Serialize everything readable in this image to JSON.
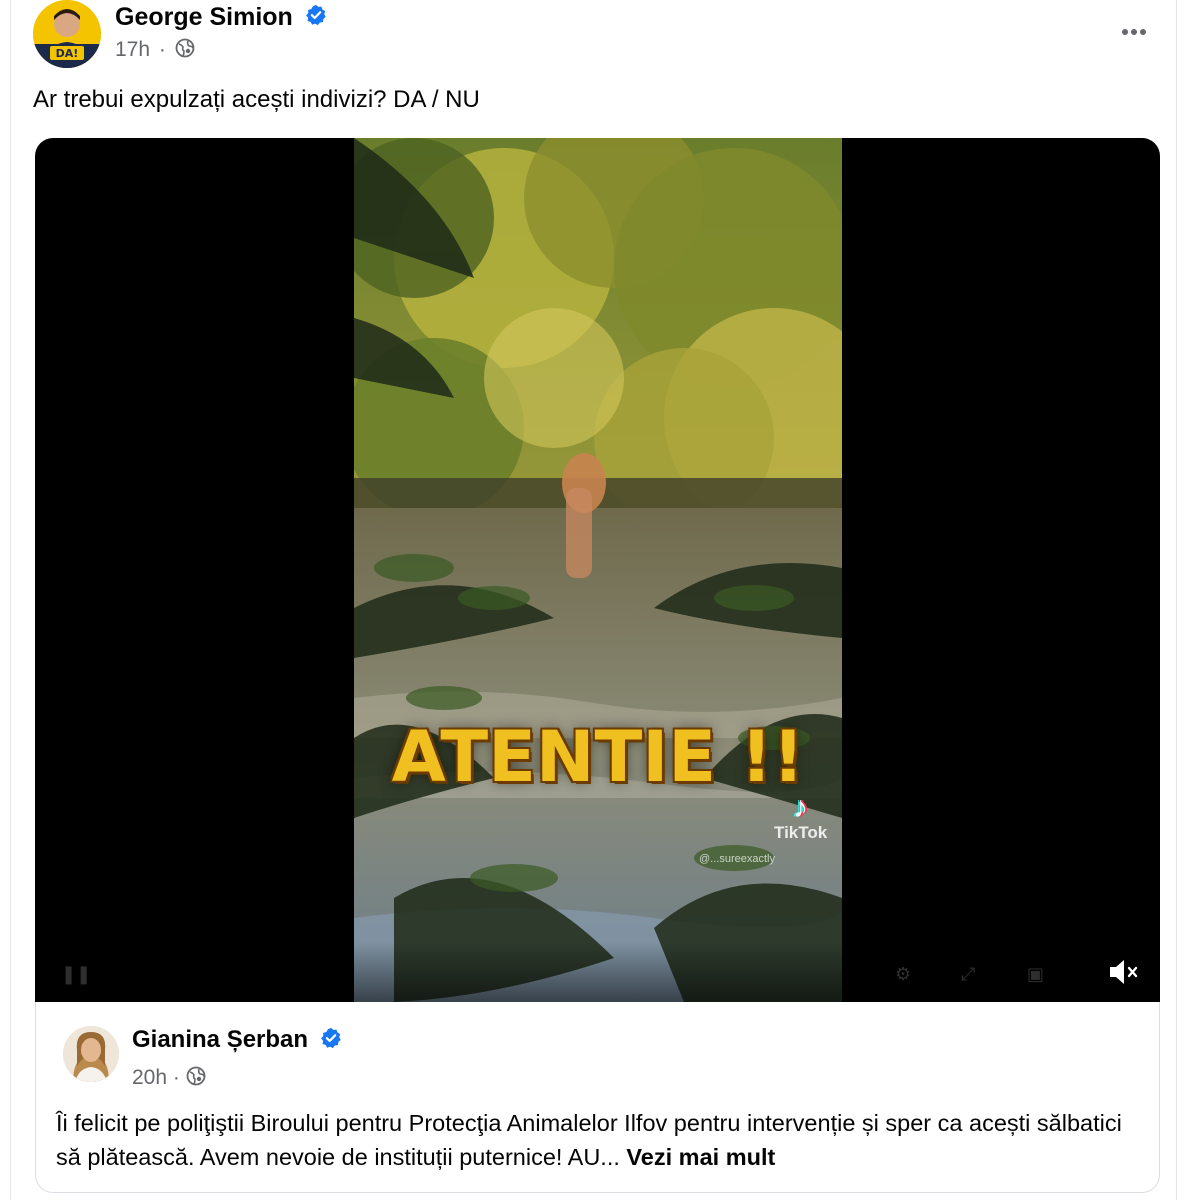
{
  "post": {
    "author": "George Simion",
    "avatar_badge": "DA!",
    "time": "17h",
    "separator": "·",
    "privacy_icon": "globe-icon",
    "menu_icon": "more-dots-icon",
    "text": "Ar trebui expulzați acești indivizi? DA / NU"
  },
  "video": {
    "overlay_text": "ATENTIE !!",
    "watermark": "TikTok",
    "watermark_handle": "@...sureexactly",
    "mute_icon": "speaker-muted-icon"
  },
  "shared_post": {
    "author": "Gianina Șerban",
    "time": "20h",
    "separator": "·",
    "privacy_icon": "globe-icon",
    "text": "Îi felicit pe poliţiştii Biroului pentru Protecţia Animalelor Ilfov pentru intervenție și sper ca acești sălbatici să plătească. Avem nevoie de instituții puternice! AU...",
    "see_more": "Vezi mai mult"
  },
  "colors": {
    "verified_badge": "#1877f2",
    "secondary_text": "#65676b",
    "overlay_text": "#f0c020"
  }
}
